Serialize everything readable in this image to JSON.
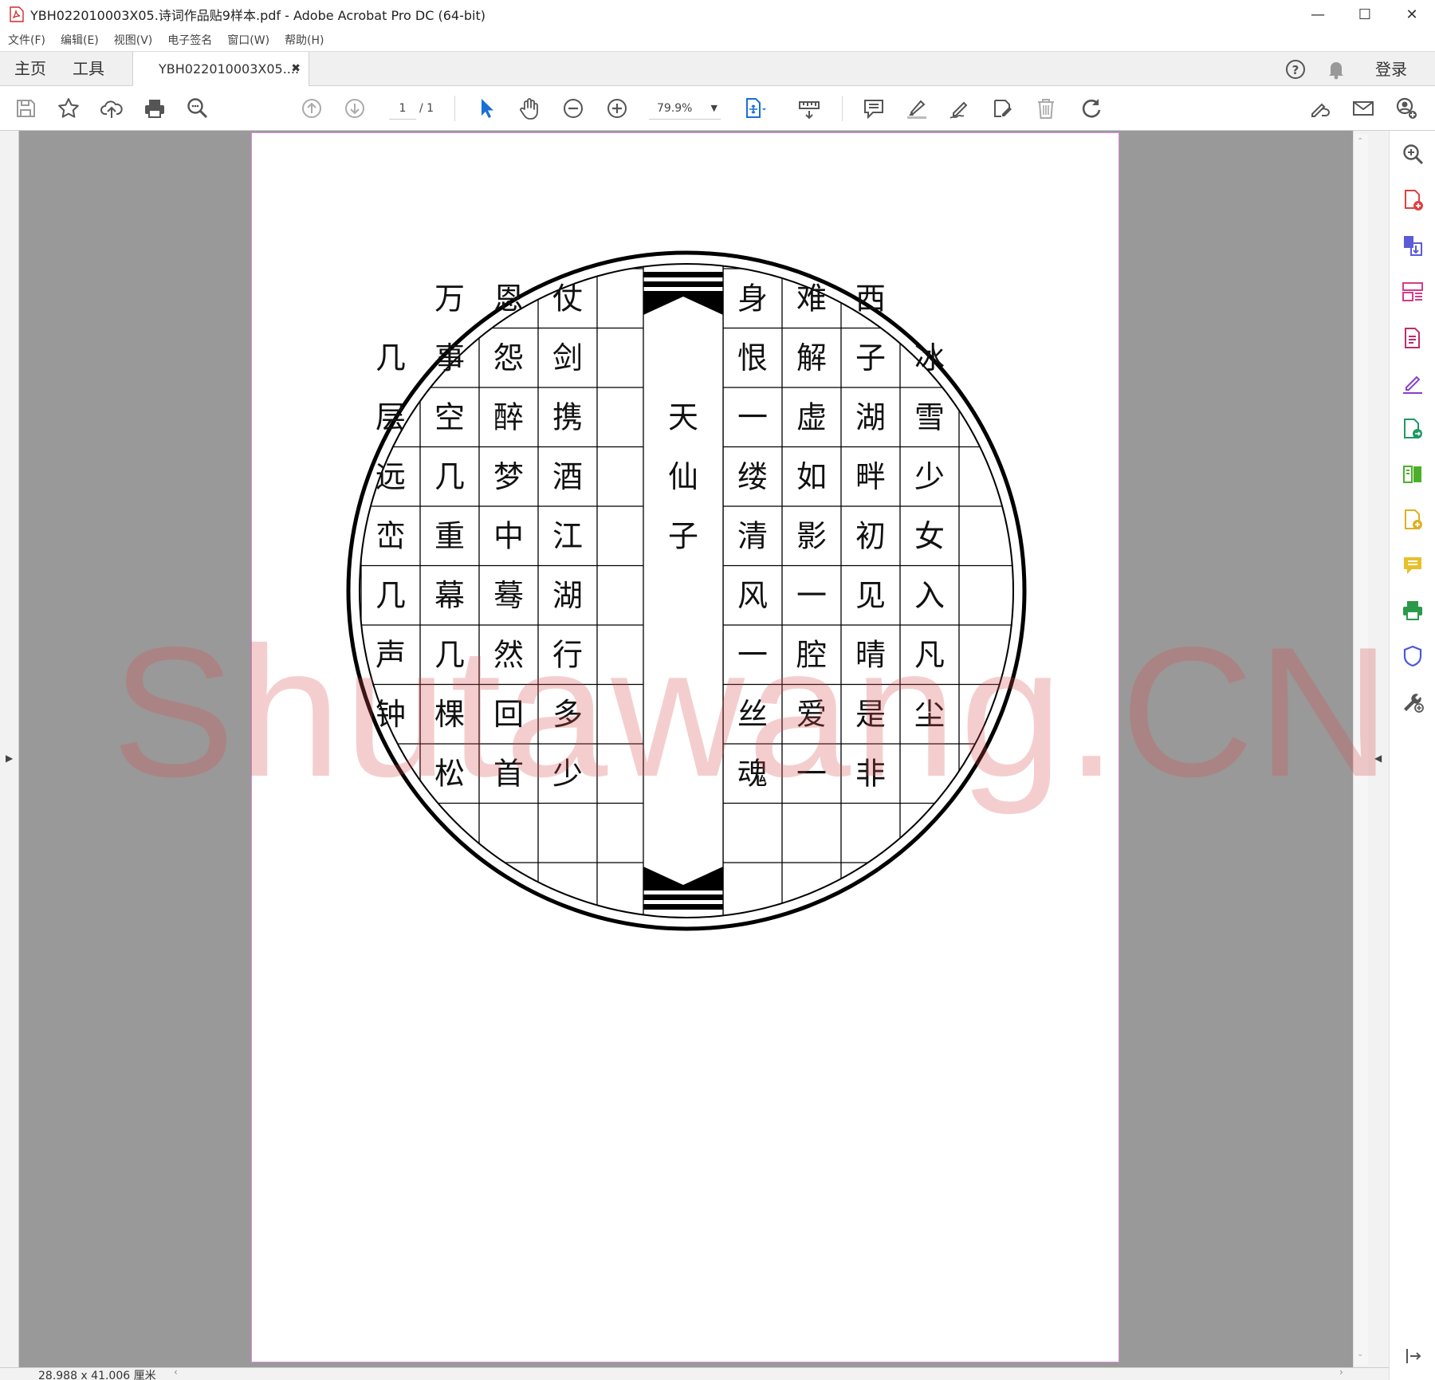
{
  "window": {
    "title": "YBH022010003X05.诗词作品贴9样本.pdf - Adobe Acrobat Pro DC (64-bit)",
    "controls": {
      "minimize": "—",
      "maximize": "☐",
      "close": "✕"
    }
  },
  "menu": [
    "文件(F)",
    "编辑(E)",
    "视图(V)",
    "电子签名",
    "窗口(W)",
    "帮助(H)"
  ],
  "tabs": {
    "home": "主页",
    "tools": "工具",
    "document": "YBH022010003X05....",
    "close": "✖"
  },
  "account": {
    "login": "登录"
  },
  "toolbar": {
    "page_current": "1",
    "page_total": "/ 1",
    "zoom": "79.9%",
    "zoom_caret": "▼"
  },
  "poem": {
    "title_chars": [
      "天",
      "仙",
      "子"
    ],
    "left_columns": [
      [
        "",
        "几",
        "层",
        "远",
        "峦",
        "几",
        "声",
        "钟",
        ""
      ],
      [
        "万",
        "事",
        "空",
        "几",
        "重",
        "幕",
        "几",
        "棵",
        "松"
      ],
      [
        "恩",
        "怨",
        "醉",
        "梦",
        "中",
        "蓦",
        "然",
        "回",
        "首"
      ],
      [
        "仗",
        "剑",
        "携",
        "酒",
        "江",
        "湖",
        "行",
        "多",
        "少"
      ]
    ],
    "right_columns": [
      [
        "身",
        "恨",
        "一",
        "缕",
        "清",
        "风",
        "一",
        "丝",
        "魂"
      ],
      [
        "难",
        "解",
        "虚",
        "如",
        "影",
        "一",
        "腔",
        "爱",
        "一"
      ],
      [
        "西",
        "子",
        "湖",
        "畔",
        "初",
        "见",
        "晴",
        "是",
        "非"
      ],
      [
        "",
        "冰",
        "雪",
        "少",
        "女",
        "入",
        "凡",
        "尘",
        ""
      ]
    ]
  },
  "watermark": "Shutawang.CN",
  "status": {
    "page_size": "28.988 x 41.006 厘米"
  },
  "colors": {
    "accent_blue": "#1a6fd4",
    "page_border": "#d88bd8",
    "watermark": "#d75050"
  }
}
